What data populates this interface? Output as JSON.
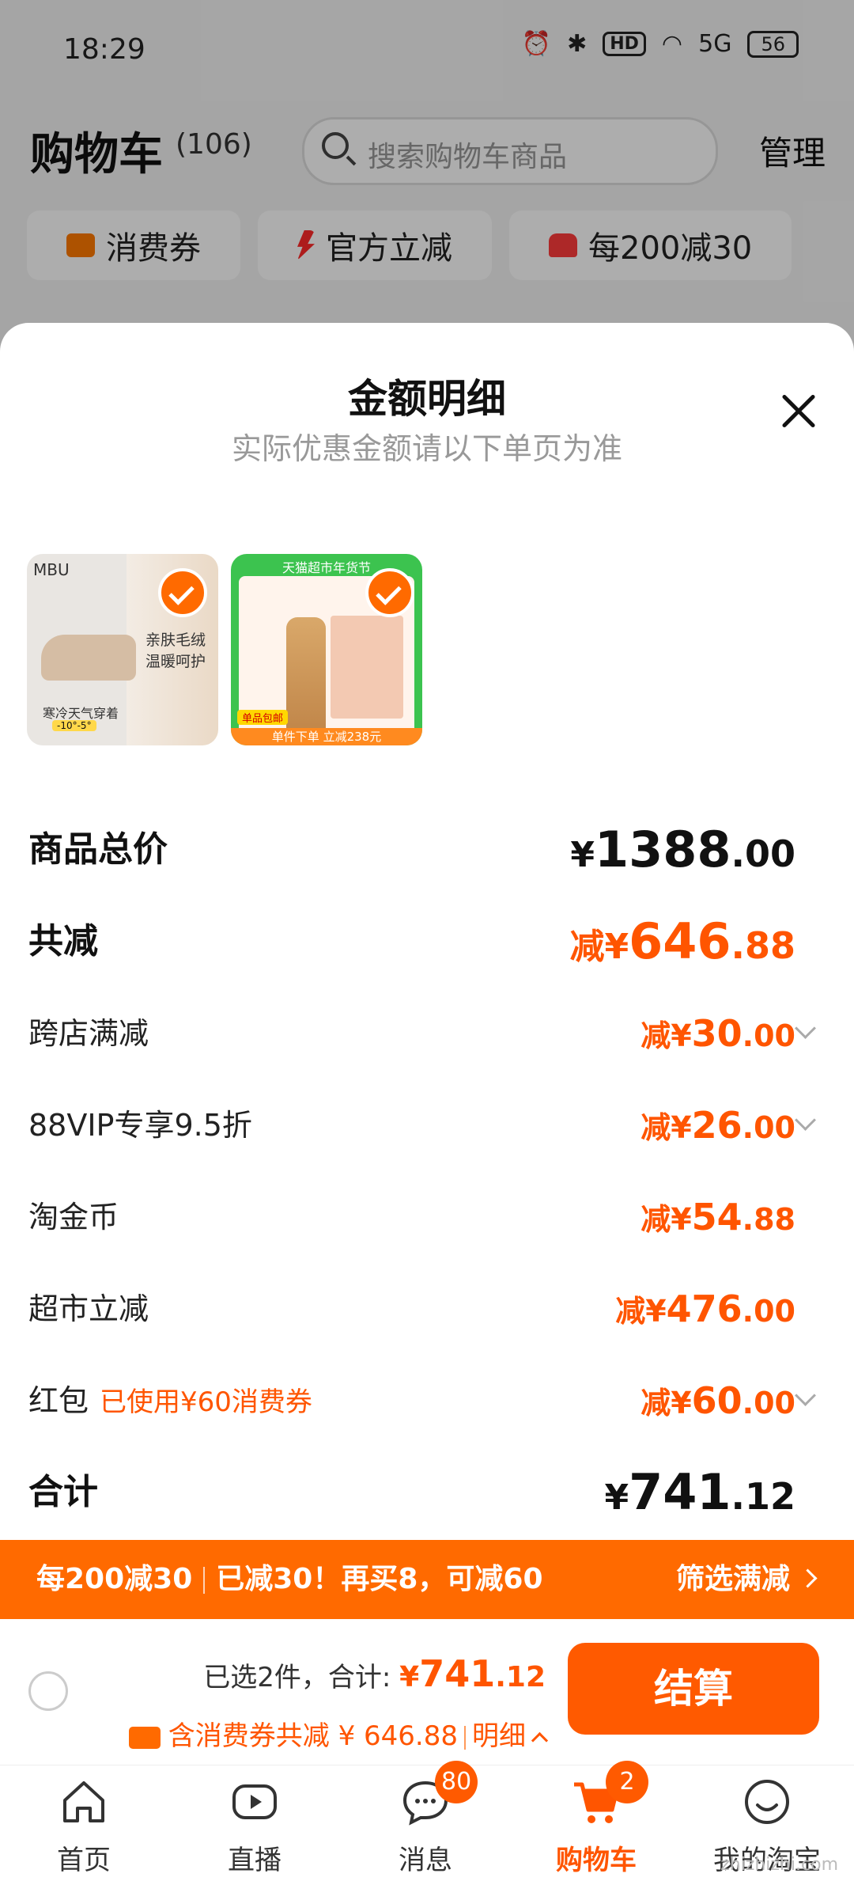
{
  "status_bar": {
    "time": "18:29",
    "hd": "HD",
    "signal": "5G",
    "battery": "56"
  },
  "header": {
    "title": "购物车",
    "count": "(106)",
    "search_placeholder": "搜索购物车商品",
    "manage": "管理"
  },
  "chips": [
    {
      "label": "消费券"
    },
    {
      "label": "官方立减"
    },
    {
      "label": "每200减30"
    }
  ],
  "sheet": {
    "title": "金额明细",
    "subtitle": "实际优惠金额请以下单页为准",
    "products": [
      {
        "brand": "MBU",
        "text1": "亲肤毛绒",
        "text2": "温暖呵护",
        "foot": "寒冷天气穿着",
        "foot_badge": "-10°-5°"
      },
      {
        "top": "天猫超市年货节",
        "band": "单件下单 立减238元",
        "pill": "单品包邮"
      }
    ],
    "rows": {
      "total": {
        "label": "商品总价",
        "prefix": "¥",
        "int": "1388",
        "dec": ".00"
      },
      "saved": {
        "label": "共减",
        "prefix": "减¥",
        "int": "646",
        "dec": ".88"
      },
      "cross": {
        "label": "跨店满减",
        "prefix": "减¥",
        "int": "30",
        "dec": ".00"
      },
      "vip": {
        "label": "88VIP专享9.5折",
        "prefix": "减¥",
        "int": "26",
        "dec": ".00"
      },
      "coin": {
        "label": "淘金币",
        "prefix": "减¥",
        "int": "54",
        "dec": ".88"
      },
      "market": {
        "label": "超市立减",
        "prefix": "减¥",
        "int": "476",
        "dec": ".00"
      },
      "redpack": {
        "label": "红包",
        "note": "已使用¥60消费券",
        "prefix": "减¥",
        "int": "60",
        "dec": ".00"
      },
      "sum": {
        "label": "合计",
        "prefix": "¥",
        "int": "741",
        "dec": ".12"
      }
    }
  },
  "promo_bar": {
    "part1": "每200减30",
    "part2": "已减30！再买8，可减60",
    "action": "筛选满减"
  },
  "checkout": {
    "selected": "已选2件，合计:",
    "amount_prefix": "¥",
    "amount_int": "741",
    "amount_dec": ".12",
    "coupon_text": "含消费券共减 ¥ 646.88",
    "detail": "明细",
    "button": "结算"
  },
  "tabs": [
    {
      "label": "首页"
    },
    {
      "label": "直播"
    },
    {
      "label": "消息",
      "badge": "80"
    },
    {
      "label": "购物车",
      "badge": "2"
    },
    {
      "label": "我的淘宝"
    }
  ],
  "watermark": "zhizhizhi.com",
  "colors": {
    "accent": "#ff5500",
    "promo_bg": "#ff6a00"
  }
}
